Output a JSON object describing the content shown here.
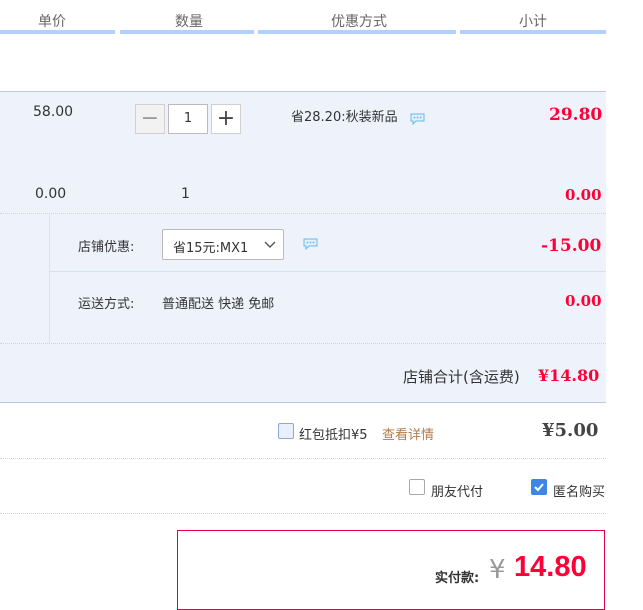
{
  "header": {
    "unit_price": "单价",
    "quantity": "数量",
    "discount_method": "优惠方式",
    "subtotal": "小计"
  },
  "item1": {
    "unit_price": "58.00",
    "quantity": "1",
    "minus": "−",
    "plus": "+",
    "promo": "省28.20:秋装新品",
    "subtotal": "29.80"
  },
  "item2": {
    "unit_price": "0.00",
    "quantity": "1",
    "subtotal": "0.00"
  },
  "store_discount": {
    "label": "店铺优惠:",
    "selected": "省15元:MX1",
    "amount": "-15.00"
  },
  "shipping": {
    "label": "运送方式:",
    "value": "普通配送 快递 免邮",
    "amount": "0.00"
  },
  "store_total": {
    "label": "店铺合计(含运费)",
    "amount": "¥14.80"
  },
  "red_packet": {
    "label": "红包抵扣¥5",
    "link": "查看详情",
    "amount": "¥5.00"
  },
  "options": {
    "friend_pay": "朋友代付",
    "anonymous": "匿名购买"
  },
  "payment": {
    "label": "实付款:",
    "currency": "¥",
    "amount": "14.80"
  },
  "colors": {
    "accent_red": "#ff0036",
    "header_line": "#b2d1ff",
    "row_bg": "#eef3fb",
    "checkbox_blue": "#3d86e6",
    "link_brown": "#b07b4a"
  }
}
